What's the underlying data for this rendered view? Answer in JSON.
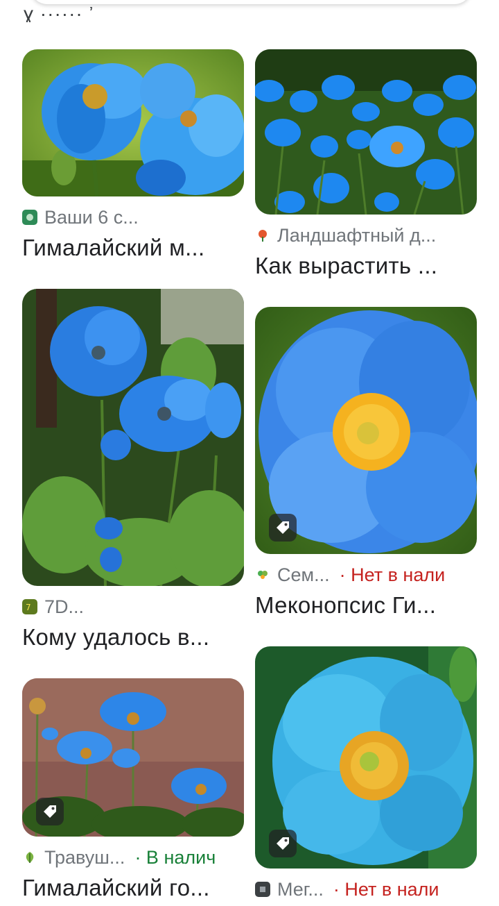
{
  "top": {
    "cut_text": "ɣ ······ ʼ"
  },
  "cards": [
    {
      "source": "Ваши 6 с...",
      "title": "Гималайский м...",
      "favicon": "green-square-icon",
      "status": ""
    },
    {
      "source": "Ландшафтный д...",
      "title": "Как вырастить ...",
      "favicon": "red-flower-icon",
      "status": ""
    },
    {
      "source": "7D...",
      "title": "Кому удалось в...",
      "favicon": "yellow-green-logo-icon",
      "status": ""
    },
    {
      "source": "Сем...",
      "title": "Меконопсис Ги...",
      "favicon": "green-sprout-icon",
      "status": "· Нет в нали",
      "status_color": "#c5221f"
    },
    {
      "source": "Травуш...",
      "title": "Гималайский го...",
      "favicon": "green-leaf-icon",
      "status": "· В налич",
      "status_color": "#188038"
    },
    {
      "source": "Мег...",
      "title": "",
      "favicon": "dark-square-icon",
      "status": "· Нет в нали",
      "status_color": "#c5221f"
    }
  ],
  "colors": {
    "accent_red": "#c5221f",
    "accent_green": "#188038",
    "text_secondary": "#70757a"
  }
}
